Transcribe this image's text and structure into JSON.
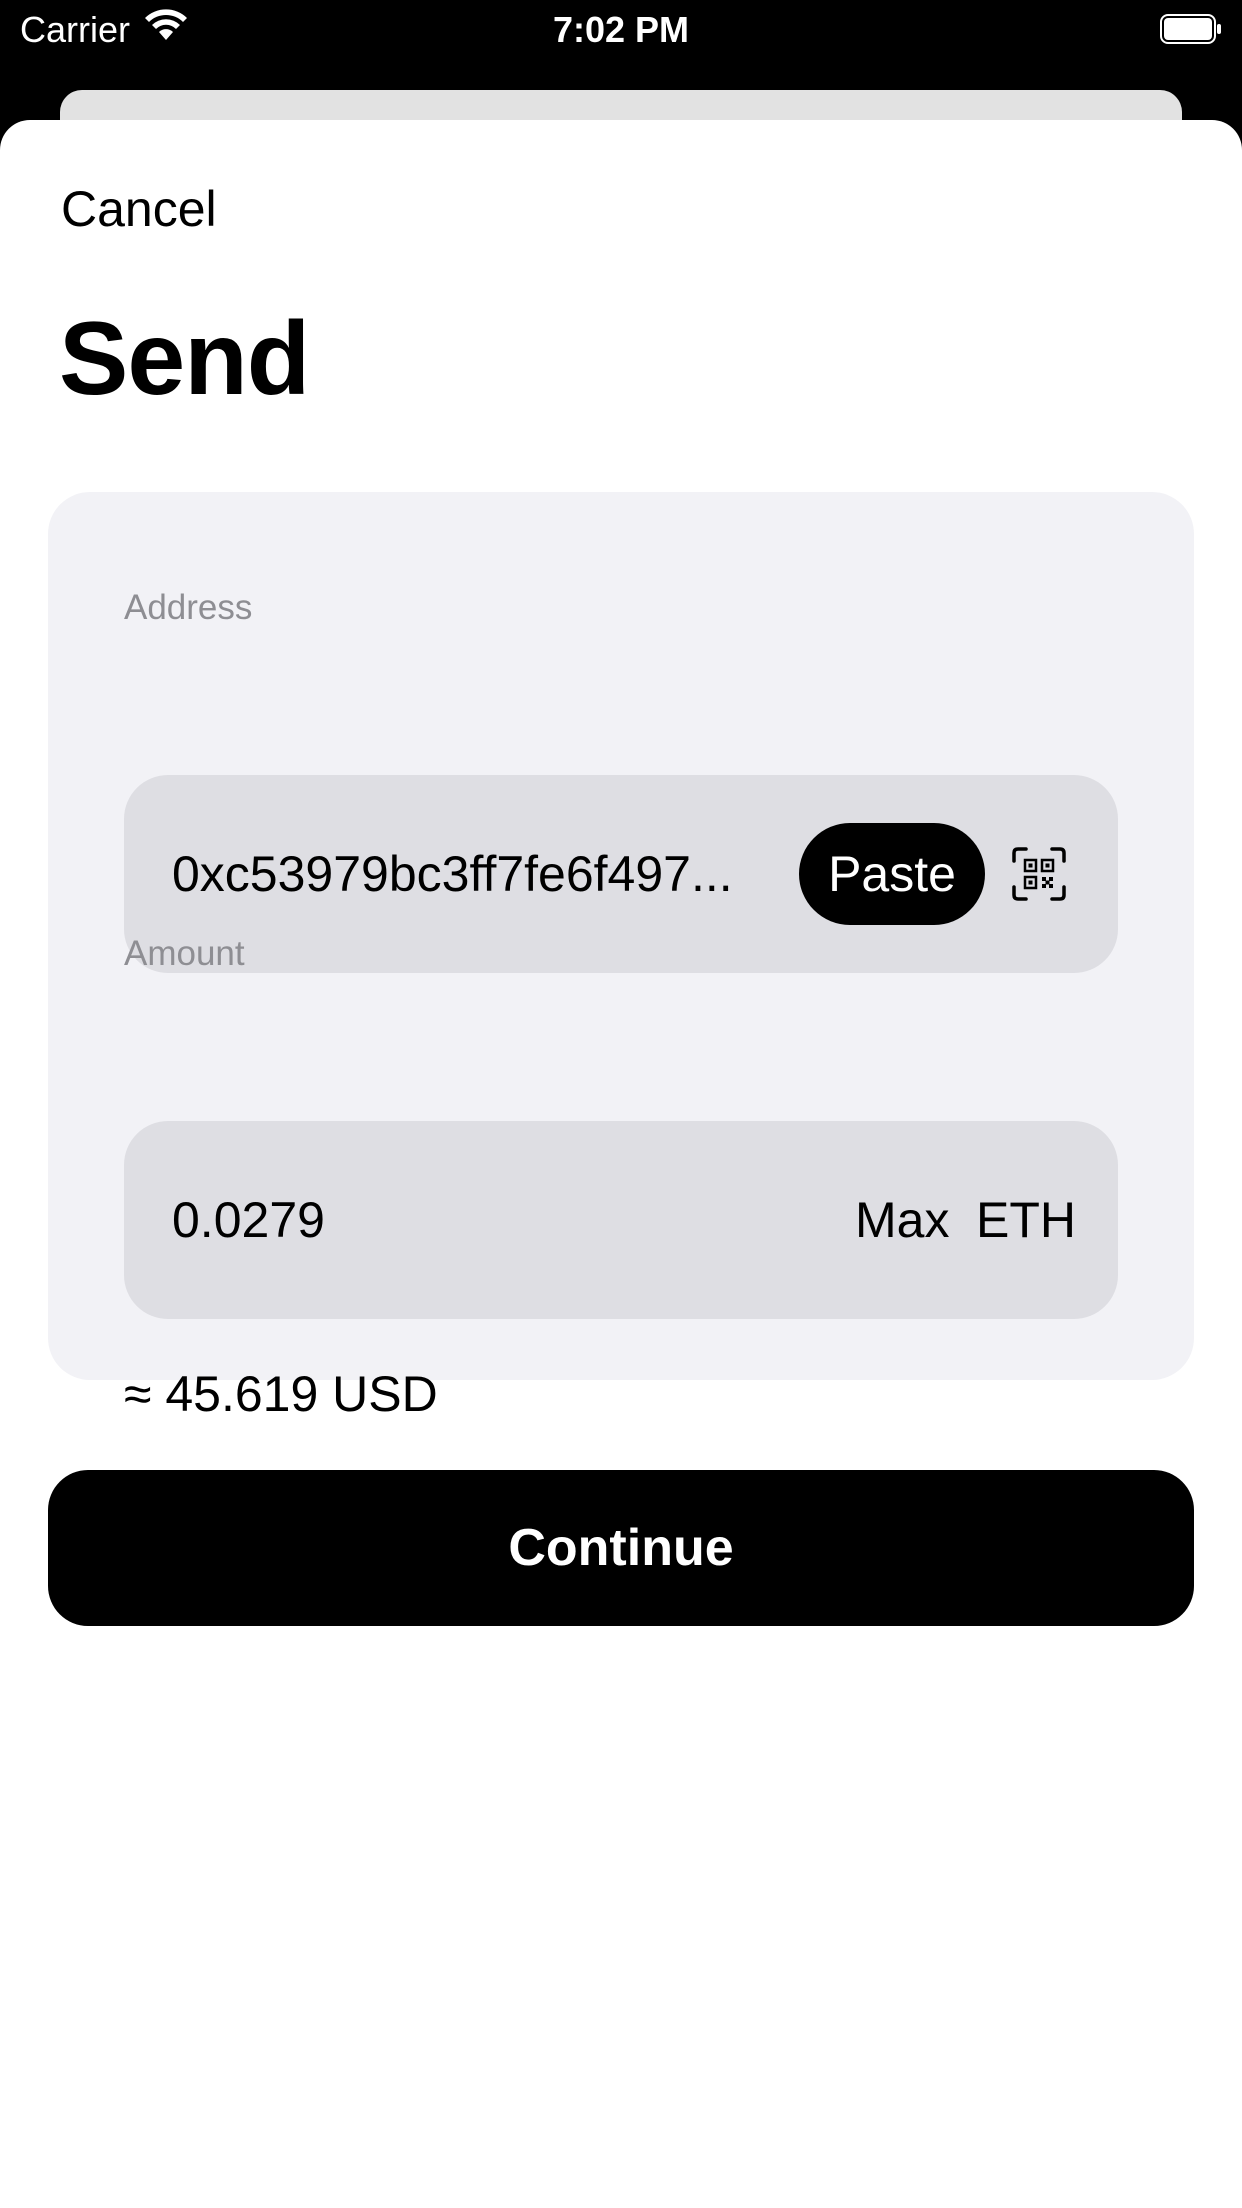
{
  "status_bar": {
    "carrier": "Carrier",
    "time": "7:02 PM"
  },
  "header": {
    "cancel_label": "Cancel",
    "title": "Send"
  },
  "form": {
    "address": {
      "label": "Address",
      "value": "0xc53979bc3ff7fe6f497...",
      "paste_label": "Paste"
    },
    "amount": {
      "label": "Amount",
      "value": "0.0279",
      "max_label": "Max",
      "currency": "ETH"
    },
    "fiat_estimate": "≈ 45.619 USD"
  },
  "actions": {
    "continue_label": "Continue"
  },
  "colors": {
    "background": "#000000",
    "sheet": "#ffffff",
    "card": "#f2f2f6",
    "field": "#dedee3",
    "label": "#8e8e93",
    "primary_button": "#000000",
    "primary_button_text": "#ffffff"
  },
  "icons": {
    "wifi": "wifi-icon",
    "battery": "battery-icon",
    "qr_scan": "qr-scan-icon"
  }
}
